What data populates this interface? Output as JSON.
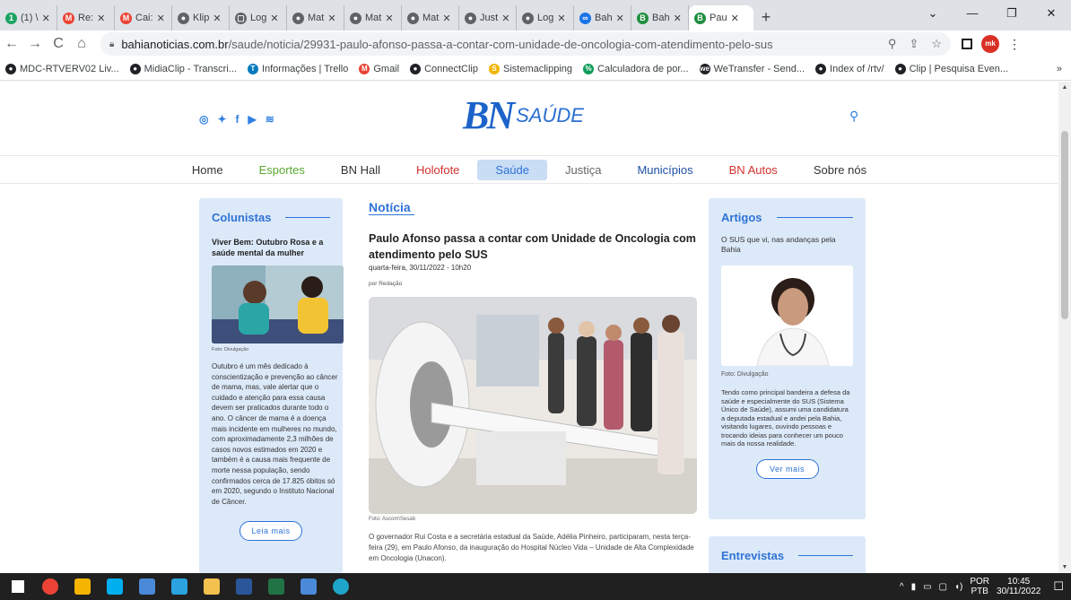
{
  "browser": {
    "tabs": [
      {
        "label": "(1) \\",
        "color": "#1ea362",
        "glyph": "1"
      },
      {
        "label": "Re:",
        "color": "#ea4335",
        "glyph": "M"
      },
      {
        "label": "Cai:",
        "color": "#ea4335",
        "glyph": "M"
      },
      {
        "label": "Klip",
        "color": "#5f6368",
        "glyph": "●"
      },
      {
        "label": "Log",
        "color": "#5f6368",
        "glyph": "▢"
      },
      {
        "label": "Mat",
        "color": "#5f6368",
        "glyph": "●"
      },
      {
        "label": "Mat",
        "color": "#5f6368",
        "glyph": "●"
      },
      {
        "label": "Mat",
        "color": "#5f6368",
        "glyph": "●"
      },
      {
        "label": "Just",
        "color": "#5f6368",
        "glyph": "●"
      },
      {
        "label": "Log",
        "color": "#5f6368",
        "glyph": "●"
      },
      {
        "label": "Bah",
        "color": "#1a73e8",
        "glyph": "∞"
      },
      {
        "label": "Bah",
        "color": "#1e8e3e",
        "glyph": "B"
      },
      {
        "label": "Pau",
        "color": "#1e8e3e",
        "glyph": "B"
      }
    ],
    "active_tab_index": 12,
    "url_domain": "bahianoticias.com.br",
    "url_path": "/saude/noticia/29931-paulo-afonso-passa-a-contar-com-unidade-de-oncologia-com-atendimento-pelo-sus",
    "bookmarks": [
      {
        "label": "MDC-RTVERV02 Liv...",
        "color": "#202124",
        "glyph": "●"
      },
      {
        "label": "MidiaClip - Transcri...",
        "color": "#202124",
        "glyph": "●"
      },
      {
        "label": "Informações | Trello",
        "color": "#0079bf",
        "glyph": "T"
      },
      {
        "label": "Gmail",
        "color": "#ea4335",
        "glyph": "M"
      },
      {
        "label": "ConnectClip",
        "color": "#202124",
        "glyph": "●"
      },
      {
        "label": "Sistemaclipping",
        "color": "#f4b400",
        "glyph": "S"
      },
      {
        "label": "Calculadora de por...",
        "color": "#0f9d58",
        "glyph": "%"
      },
      {
        "label": "WeTransfer - Send...",
        "color": "#202124",
        "glyph": "we"
      },
      {
        "label": "Index of /rtv/",
        "color": "#202124",
        "glyph": "●"
      },
      {
        "label": "Clip | Pesquisa Even...",
        "color": "#202124",
        "glyph": "●"
      }
    ],
    "bookmarks_more": "»"
  },
  "site": {
    "logo_bn": "BN",
    "logo_section": "SAÚDE",
    "menu": [
      {
        "label": "Home",
        "color": "#333333",
        "active": false
      },
      {
        "label": "Esportes",
        "color": "#5aa832",
        "active": false
      },
      {
        "label": "BN Hall",
        "color": "#333333",
        "active": false
      },
      {
        "label": "Holofote",
        "color": "#d0312d",
        "active": false
      },
      {
        "label": "Saúde",
        "color": "#2f73d6",
        "active": true
      },
      {
        "label": "Justiça",
        "color": "#666666",
        "active": false
      },
      {
        "label": "Municípios",
        "color": "#1c4fa3",
        "active": false
      },
      {
        "label": "BN Autos",
        "color": "#d0312d",
        "active": false
      },
      {
        "label": "Sobre nós",
        "color": "#333333",
        "active": false
      }
    ]
  },
  "left": {
    "section_title": "Colunistas",
    "article_title": "Viver Bem: Outubro Rosa e a saúde mental da mulher",
    "photo_credit": "Foto: Divulgação",
    "body": "Outubro é um mês dedicado à conscientização e prevenção ao câncer de mama, mas, vale alertar que o cuidado e atenção para essa causa devem ser praticados durante todo o ano. O câncer de mama é a doença mais incidente em mulheres no mundo, com aproximadamente 2,3 milhões de casos novos estimados em 2020 e também é a causa mais frequente de morte nessa população, sendo confirmados cerca de 17.825 óbitos só em 2020,  segundo o Instituto Nacional de  Câncer.",
    "button": "Leia mais"
  },
  "center": {
    "tag": "Notícia",
    "headline": "Paulo Afonso passa a contar com Unidade de Oncologia com atendimento pelo SUS",
    "date": "quarta-feira, 30/11/2022 - 10h20",
    "author": "por Redação",
    "photo_credit": "Foto: Ascom\\Sesab",
    "lead": "O governador Rui Costa e a secretária estadual da Saúde, Adélia Pinheiro, participaram, nesta terça-feira (29), em Paulo Afonso, da inauguração do Hospital Núcleo Vida – Unidade de Alta Complexidade em Oncologia (Unacon)."
  },
  "right": {
    "section_title": "Artigos",
    "article_title": "O SUS que vi, nas andanças pela Bahia",
    "photo_credit": "Foto: Divulgação",
    "body": "Tendo como principal bandeira a defesa da saúde e especialmente do SUS (Sistema Único de Saúde), assumi uma candidatura a deputada estadual e andei pela Bahia, visitando lugares, ouvindo pessoas e trocando ideias para conhecer um pouco mais da nossa realidade.",
    "button": "Ver mais",
    "section2_title": "Entrevistas"
  },
  "taskbar": {
    "lang_top": "POR",
    "lang_bottom": "PTB",
    "time": "10:45",
    "date": "30/11/2022",
    "apps": [
      {
        "name": "windows-start-icon",
        "color": "#ffffff"
      },
      {
        "name": "chrome-icon",
        "color": "#ea4335"
      },
      {
        "name": "app-yellow-icon",
        "color": "#f4b400"
      },
      {
        "name": "skype-icon",
        "color": "#00aff0"
      },
      {
        "name": "app-blue-icon",
        "color": "#4a8ad8"
      },
      {
        "name": "telegram-icon",
        "color": "#2aa3df"
      },
      {
        "name": "file-explorer-icon",
        "color": "#f2c14e"
      },
      {
        "name": "word-icon",
        "color": "#2b579a"
      },
      {
        "name": "excel-icon",
        "color": "#217346"
      },
      {
        "name": "app-blue2-icon",
        "color": "#4a8ad8"
      },
      {
        "name": "edge-icon",
        "color": "#1fa5c9"
      }
    ]
  }
}
